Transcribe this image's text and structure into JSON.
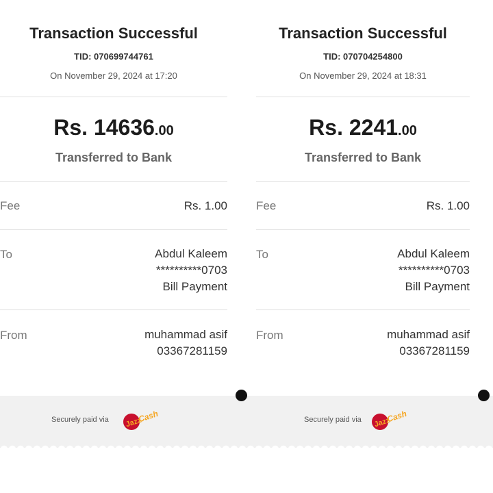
{
  "receipts": [
    {
      "title": "Transaction Successful",
      "tid": "TID: 070699744761",
      "date": "On November 29, 2024 at 17:20",
      "amount_main": "Rs. 14636",
      "amount_decimal": ".00",
      "subtitle": "Transferred to Bank",
      "fee_label": "Fee",
      "fee_value": "Rs. 1.00",
      "to_label": "To",
      "to_name": "Abdul Kaleem",
      "to_account": "**********0703",
      "to_type": "Bill Payment",
      "from_label": "From",
      "from_name": "muhammad asif",
      "from_number": "03367281159"
    },
    {
      "title": "Transaction Successful",
      "tid": "TID: 070704254800",
      "date": "On November 29, 2024 at 18:31",
      "amount_main": "Rs. 2241",
      "amount_decimal": ".00",
      "subtitle": "Transferred to Bank",
      "fee_label": "Fee",
      "fee_value": "Rs. 1.00",
      "to_label": "To",
      "to_name": "Abdul Kaleem",
      "to_account": "**********0703",
      "to_type": "Bill Payment",
      "from_label": "From",
      "from_name": "muhammad asif",
      "from_number": "03367281159"
    }
  ],
  "footer": {
    "secure_text_left": "Securely paid via",
    "secure_text_right": "Securely paid via",
    "logo_text": "JazzCash",
    "logo_icon": "jazzcash-logo-icon"
  },
  "colors": {
    "logo_red": "#c8102e",
    "logo_yellow": "#f5a623",
    "footer_bg": "#f1f1f1"
  }
}
